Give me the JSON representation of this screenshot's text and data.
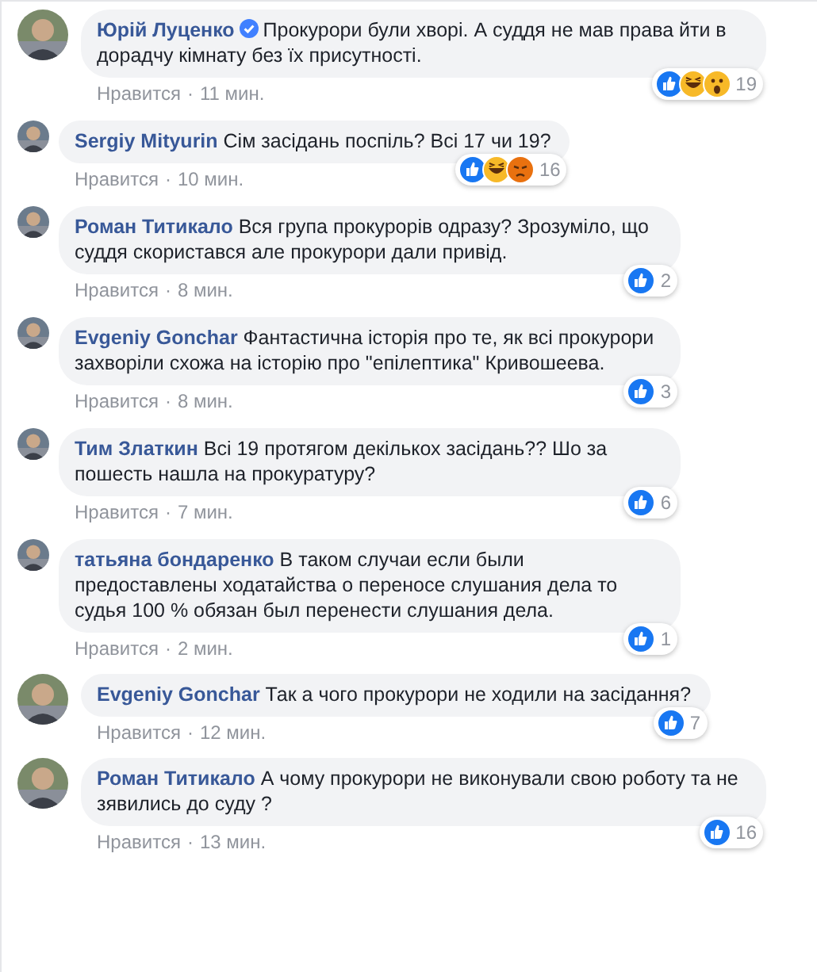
{
  "comments": [
    {
      "author": "Юрій Луценко",
      "verified": true,
      "text": "Прокурори були хворі. А суддя не мав права йти в дорадчу кімнату без їх присутності.",
      "reactions": [
        {
          "kind": "like"
        },
        {
          "kind": "haha"
        },
        {
          "kind": "wow"
        }
      ],
      "reaction_count": "19",
      "like_label": "Нравится",
      "separator": "·",
      "time": "11 мин.",
      "replies": [
        {
          "author": "Sergiy Mityurin",
          "verified": false,
          "text": "Сім засідань поспіль? Всі 17 чи 19?",
          "reactions": [
            {
              "kind": "like"
            },
            {
              "kind": "haha"
            },
            {
              "kind": "angry"
            }
          ],
          "reaction_count": "16",
          "like_label": "Нравится",
          "separator": "·",
          "time": "10 мин."
        },
        {
          "author": "Роман Титикало",
          "verified": false,
          "text": "Вся група прокурорів одразу? Зрозуміло, що суддя скористався але прокурори дали привід.",
          "reactions": [
            {
              "kind": "like"
            }
          ],
          "reaction_count": "2",
          "like_label": "Нравится",
          "separator": "·",
          "time": "8 мин."
        },
        {
          "author": "Evgeniy Gonchar",
          "verified": false,
          "text": "Фантастична історія про те, як всі прокурори захворіли схожа на історію про \"епілептика\" Кривошеева.",
          "reactions": [
            {
              "kind": "like"
            }
          ],
          "reaction_count": "3",
          "like_label": "Нравится",
          "separator": "·",
          "time": "8 мин."
        },
        {
          "author": "Тим Златкин",
          "verified": false,
          "text": "Всі 19 протягом декількох засідань?? Шо за пошесть нашла на прокуратуру?",
          "reactions": [
            {
              "kind": "like"
            }
          ],
          "reaction_count": "6",
          "like_label": "Нравится",
          "separator": "·",
          "time": "7 мин."
        },
        {
          "author": "татьяна бондаренко",
          "verified": false,
          "text": "В таком случаи если были предоставлены ходатайства о переносе слушания дела то судья 100 % обязан был перенести слушания дела.",
          "reactions": [
            {
              "kind": "like"
            }
          ],
          "reaction_count": "1",
          "like_label": "Нравится",
          "separator": "·",
          "time": "2 мин."
        }
      ]
    },
    {
      "author": "Evgeniy Gonchar",
      "verified": false,
      "text": "Так а чого прокурори не ходили на засідання?",
      "reactions": [
        {
          "kind": "like"
        }
      ],
      "reaction_count": "7",
      "like_label": "Нравится",
      "separator": "·",
      "time": "12 мин."
    },
    {
      "author": "Роман Титикало",
      "verified": false,
      "text": "А чому прокурори не виконували свою роботу та не зявились до суду ?",
      "reactions": [
        {
          "kind": "like"
        }
      ],
      "reaction_count": "16",
      "like_label": "Нравится",
      "separator": "·",
      "time": "13 мин."
    }
  ]
}
